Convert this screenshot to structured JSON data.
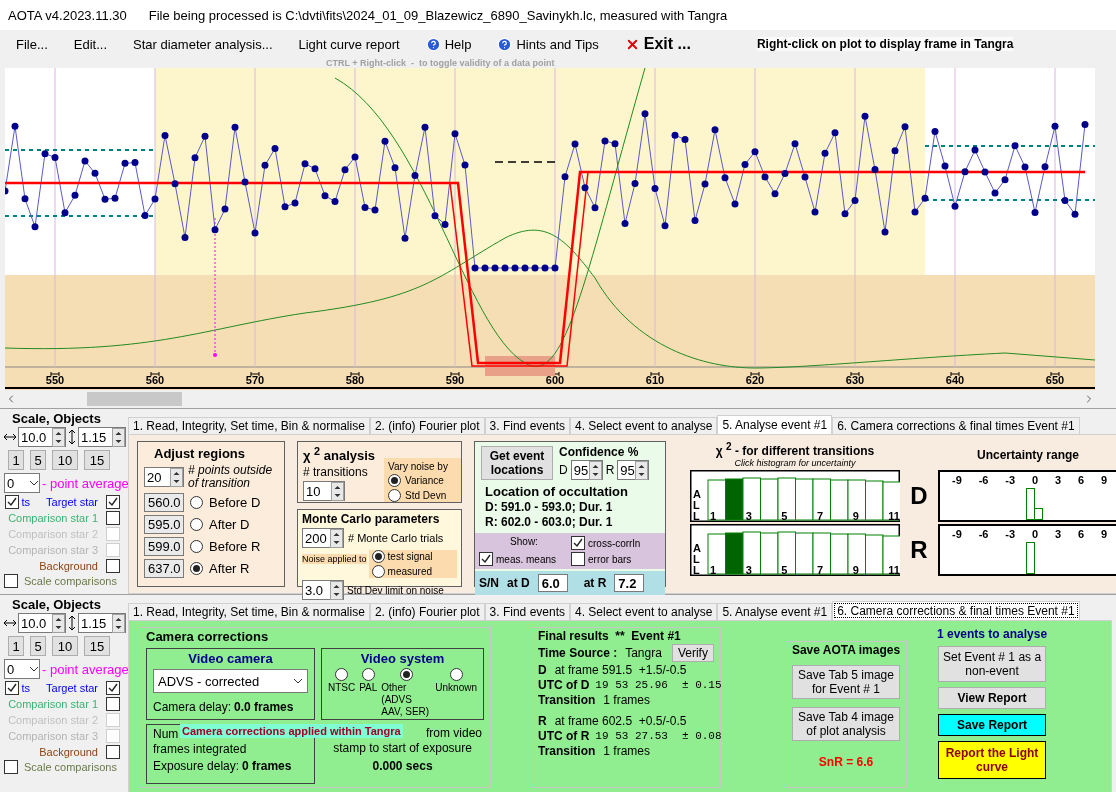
{
  "window": {
    "title": "AOTA v4.2023.11.30",
    "file_info": "File being processed is C:\\dvti\\fits\\2024_01_09_Blazewicz_6890_Savinykh.lc, measured with Tangra"
  },
  "menu": [
    {
      "label": "File...",
      "kind": "text"
    },
    {
      "label": "Edit...",
      "kind": "text"
    },
    {
      "label": "Star diameter analysis...",
      "kind": "text"
    },
    {
      "label": "Light curve report",
      "kind": "text"
    },
    {
      "label": "Help",
      "kind": "help"
    },
    {
      "label": "Hints and Tips",
      "kind": "help"
    },
    {
      "label": "Exit ...",
      "kind": "exit"
    }
  ],
  "plot_hint": "Right-click on plot to display frame in Tangra",
  "toggle_hint": "CTRL + Right-click  -  to toggle validity of a data point",
  "plot": {
    "x_labels": [
      "550",
      "560",
      "570",
      "580",
      "590",
      "600",
      "610",
      "620",
      "630",
      "640",
      "650"
    ]
  },
  "panels": [
    {
      "sidebar": {
        "title": "Scale,  Objects",
        "h_scale": "10.0",
        "v_scale": "1.15",
        "zoom_buttons": [
          "1",
          "5",
          "10",
          "15"
        ],
        "average": {
          "value": "0",
          "label": "- point average"
        },
        "pts": {
          "label": "ts",
          "checked": true
        },
        "objects": [
          {
            "label": "Target star",
            "checked": true,
            "disabled": false,
            "color": "#0000ff"
          },
          {
            "label": "Comparison star 1",
            "checked": false,
            "disabled": false,
            "color": "#3cb371"
          },
          {
            "label": "Comparison star 2",
            "checked": false,
            "disabled": true,
            "color": "#c0c0c0"
          },
          {
            "label": "Comparison star 3",
            "checked": false,
            "disabled": true,
            "color": "#b4b4b4"
          },
          {
            "label": "Background",
            "checked": false,
            "disabled": false,
            "color": "#8b4513"
          }
        ],
        "scale_comparisons": {
          "label": "Scale comparisons",
          "checked": false
        }
      },
      "tabs": [
        {
          "label": "1.  Read, Integrity, Set time, Bin & normalise",
          "selected": false
        },
        {
          "label": "2. (info)  Fourier plot",
          "selected": false
        },
        {
          "label": "3. Find events",
          "selected": false
        },
        {
          "label": "4. Select event to analyse",
          "selected": false
        },
        {
          "label": "5. Analyse event #1",
          "selected": true
        },
        {
          "label": "6. Camera corrections & final times Event #1",
          "selected": false
        }
      ],
      "content": {
        "kind": "analyse",
        "adjust": {
          "title": "Adjust regions",
          "points": "20",
          "points_hint": "# points outside of transition",
          "regions": [
            {
              "value": "560.0",
              "label": "Before D",
              "selected": false
            },
            {
              "value": "595.0",
              "label": "After D",
              "selected": false
            },
            {
              "value": "599.0",
              "label": "Before R",
              "selected": false
            },
            {
              "value": "637.0",
              "label": "After R",
              "selected": true
            }
          ]
        },
        "chi2": {
          "title": "χ $^{2}$ analysis",
          "transitions_label": "# transitions",
          "transitions": "10",
          "vary_title": "Vary noise by",
          "vary_options": [
            {
              "label": "Variance",
              "selected": true
            },
            {
              "label": "Std Devn",
              "selected": false
            }
          ]
        },
        "monte_carlo": {
          "title": "Monte Carlo parameters",
          "trials": "200",
          "trials_label": "# Monte Carlo trials",
          "noise_label": "Noise applied to",
          "noise_options": [
            {
              "label": "test signal",
              "selected": true
            },
            {
              "label": "measured",
              "selected": false
            }
          ],
          "std": "3.0",
          "std_label": "Std Dev limit on noise"
        },
        "locations": {
          "button": "Get event locations",
          "confidence_title": "Confidence %",
          "d_label": "D",
          "d_value": "95",
          "r_label": "R",
          "r_value": "95",
          "title": "Location of occultation",
          "lines": [
            "D: 591.0 - 593.0; Dur. 1",
            "R: 602.0 - 603.0; Dur. 1"
          ],
          "show_label": "Show:",
          "show": [
            {
              "label": "cross-corrln",
              "checked": true
            },
            {
              "label": "meas. means",
              "checked": true
            },
            {
              "label": "error bars",
              "checked": false
            }
          ],
          "sn_label": "S/N",
          "at_d": "at D",
          "sn_d": "6.0",
          "at_r": "at R",
          "sn_r": "7.2"
        },
        "histogram": {
          "title": "χ $^{2}$ -  for different transitions",
          "subtitle": "Click histogram for uncertainty",
          "uncertainty_title": "Uncertainty range",
          "rows": [
            {
              "letter": "D",
              "side_letters": [
                "A",
                "L",
                "L"
              ],
              "bar_labels": [
                "1",
                "3",
                "5",
                "7",
                "9",
                "11"
              ],
              "uncertainty_labels": [
                "-9",
                "-6",
                "-3",
                "0",
                "3",
                "6",
                "9"
              ],
              "bars": [
                {
                  "selected": false
                },
                {
                  "selected": true
                },
                {
                  "selected": false
                },
                {
                  "selected": false
                },
                {
                  "selected": false
                },
                {
                  "selected": false
                },
                {
                  "selected": false
                },
                {
                  "selected": false
                },
                {
                  "selected": false
                },
                {
                  "selected": false
                },
                {
                  "selected": false
                }
              ]
            },
            {
              "letter": "R",
              "side_letters": [
                "A",
                "L",
                "L"
              ],
              "bar_labels": [
                "1",
                "3",
                "5",
                "7",
                "9",
                "11"
              ],
              "uncertainty_labels": [
                "-9",
                "-6",
                "-3",
                "0",
                "3",
                "6",
                "9"
              ],
              "bars": [
                {
                  "selected": false
                },
                {
                  "selected": true
                },
                {
                  "selected": false
                },
                {
                  "selected": false
                },
                {
                  "selected": false
                },
                {
                  "selected": false
                },
                {
                  "selected": false
                },
                {
                  "selected": false
                },
                {
                  "selected": false
                },
                {
                  "selected": false
                },
                {
                  "selected": false
                }
              ]
            }
          ]
        }
      }
    },
    {
      "sidebar": {
        "title": "Scale,  Objects",
        "h_scale": "10.0",
        "v_scale": "1.15",
        "zoom_buttons": [
          "1",
          "5",
          "10",
          "15"
        ],
        "average": {
          "value": "0",
          "label": "- point average"
        },
        "pts": {
          "label": "ts",
          "checked": true
        },
        "objects": [
          {
            "label": "Target star",
            "checked": true,
            "disabled": false,
            "color": "#0000ff"
          },
          {
            "label": "Comparison star 1",
            "checked": false,
            "disabled": false,
            "color": "#3cb371"
          },
          {
            "label": "Comparison star 2",
            "checked": false,
            "disabled": true,
            "color": "#c0c0c0"
          },
          {
            "label": "Comparison star 3",
            "checked": false,
            "disabled": true,
            "color": "#b4b4b4"
          },
          {
            "label": "Background",
            "checked": false,
            "disabled": false,
            "color": "#8b4513"
          }
        ],
        "scale_comparisons": {
          "label": "Scale comparisons",
          "checked": false
        }
      },
      "tabs": [
        {
          "label": "1.  Read, Integrity, Set time, Bin & normalise",
          "selected": false
        },
        {
          "label": "2. (info)  Fourier plot",
          "selected": false
        },
        {
          "label": "3. Find events",
          "selected": false
        },
        {
          "label": "4. Select event to analyse",
          "selected": false
        },
        {
          "label": "5. Analyse event #1",
          "selected": false
        },
        {
          "label": "6. Camera corrections & final times Event #1",
          "selected": true
        }
      ],
      "content": {
        "kind": "camera",
        "camera": {
          "title": "Camera corrections",
          "video_camera_title": "Video camera",
          "camera_select": "ADVS - corrected",
          "camera_delay_label": "Camera delay:",
          "camera_delay": "0.0 frames",
          "video_system_title": "Video system",
          "systems": [
            {
              "label": "NTSC",
              "selected": false
            },
            {
              "label": "PAL",
              "selected": false
            },
            {
              "label": "Other (ADVS AAV, SER)",
              "selected": true
            },
            {
              "label": "Unknown",
              "selected": false
            }
          ],
          "num_label": "Num",
          "frames_label": "frames integrated",
          "exposure_label": "Exposure delay:",
          "exposure": "0 frames",
          "timing_lines": [
            "from video",
            "stamp to start of exposure"
          ],
          "timing_value": "0.000 secs",
          "overlay": "Camera corrections applied within Tangra"
        },
        "final": {
          "title": "Final results  **  Event #1",
          "verify": "Verify",
          "time_source_label": "Time Source :",
          "time_source": "Tangra",
          "events": [
            {
              "letter": "D",
              "frame": "at frame 591.5  +1.5/-0.5",
              "utc_label": "UTC of D",
              "utc": "19 53 25.96",
              "err": "± 0.15",
              "transition_label": "Transition",
              "transition": "1 frames"
            },
            {
              "letter": "R",
              "frame": "at frame 602.5  +0.5/-0.5",
              "utc_label": "UTC of R",
              "utc": "19 53 27.53",
              "err": "± 0.08",
              "transition_label": "Transition",
              "transition": "1 frames"
            }
          ]
        },
        "save": {
          "title": "Save AOTA images",
          "buttons": [
            "Save Tab 5 image for Event # 1",
            "Save Tab 4 image of plot analysis"
          ],
          "snr": "SnR = 6.6"
        },
        "actions": {
          "title": "1  events to analyse",
          "buttons": [
            {
              "label": "Set Event # 1 as a non-event",
              "kind": "plain"
            },
            {
              "label": "View Report",
              "kind": "bold"
            },
            {
              "label": "Save Report",
              "kind": "cyan"
            },
            {
              "label": "Report the Light curve",
              "kind": "yellow"
            }
          ]
        }
      }
    }
  ]
}
